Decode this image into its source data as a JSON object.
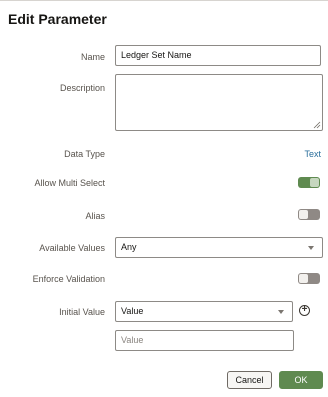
{
  "dialog": {
    "title": "Edit Parameter"
  },
  "fields": {
    "name": {
      "label": "Name",
      "value": "Ledger Set Name"
    },
    "description": {
      "label": "Description",
      "value": ""
    },
    "data_type": {
      "label": "Data Type",
      "value": "Text"
    },
    "allow_multi_select": {
      "label": "Allow Multi Select",
      "state": "on"
    },
    "alias": {
      "label": "Alias",
      "state": "off"
    },
    "available_values": {
      "label": "Available Values",
      "value": "Any"
    },
    "enforce_validation": {
      "label": "Enforce Validation",
      "state": "off"
    },
    "initial_value": {
      "label": "Initial Value",
      "value": "Value",
      "input_placeholder": "Value"
    }
  },
  "icons": {
    "add": "plus-circle-icon",
    "dropdown": "chevron-down-icon",
    "resize": "resize-grip-icon"
  },
  "colors": {
    "accent_green": "#5f8a50",
    "link_blue": "#2b6f9c",
    "toggle_off": "#8f8985"
  },
  "buttons": {
    "cancel": "Cancel",
    "ok": "OK"
  }
}
